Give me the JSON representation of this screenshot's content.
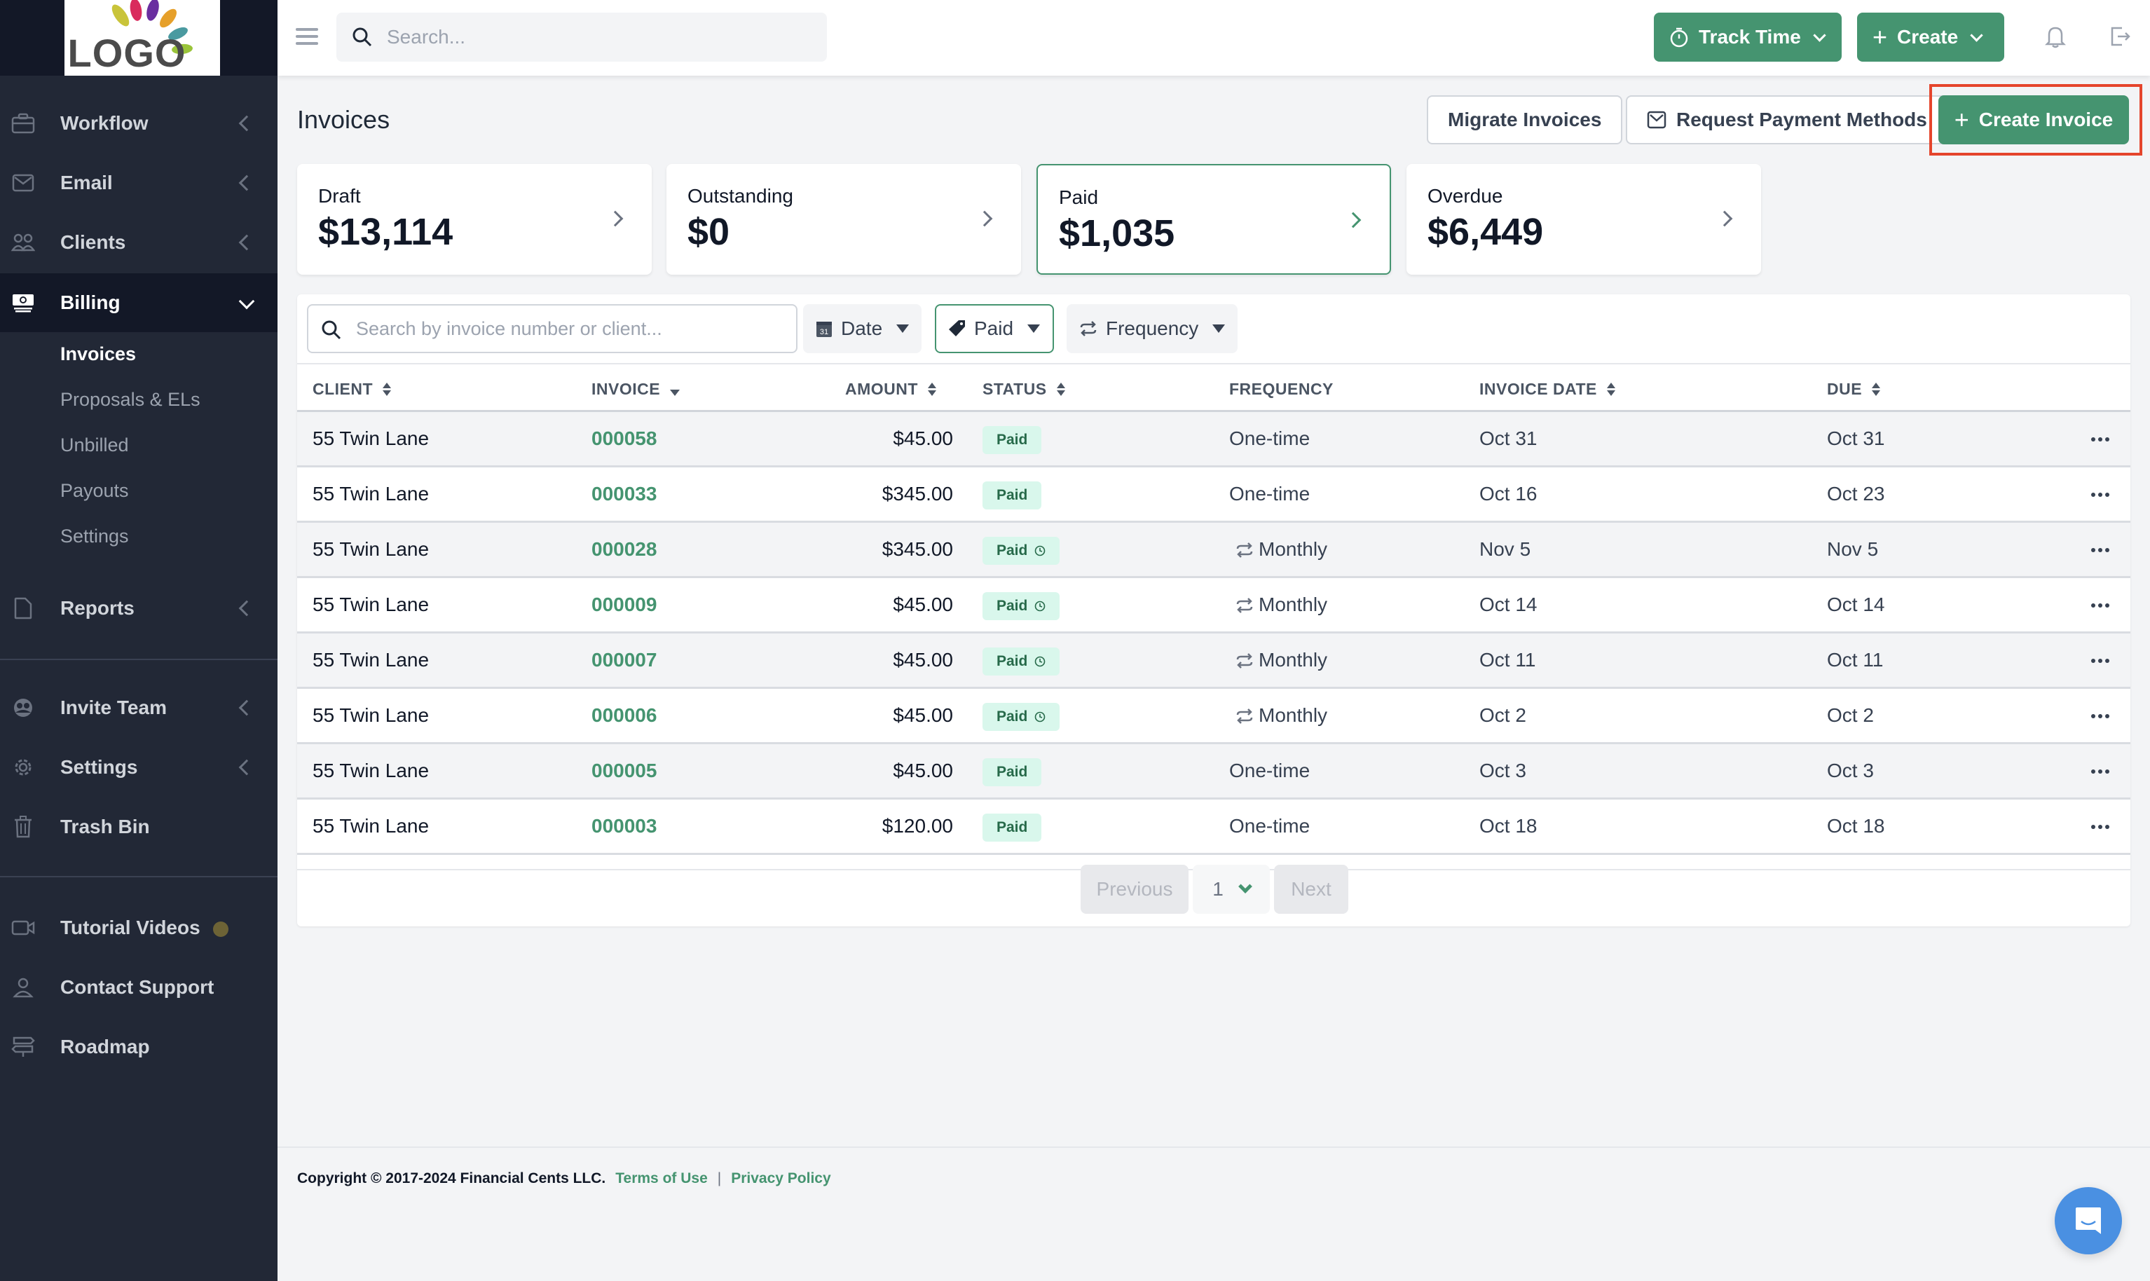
{
  "app": {
    "logo_text": "LOGO"
  },
  "sidebar": {
    "items": [
      {
        "label": "Workflow",
        "icon": "briefcase-icon",
        "expandable": true
      },
      {
        "label": "Email",
        "icon": "mail-icon",
        "expandable": true
      },
      {
        "label": "Clients",
        "icon": "users-icon",
        "expandable": true
      },
      {
        "label": "Billing",
        "icon": "money-icon",
        "expandable": true,
        "active": true
      },
      {
        "label": "Reports",
        "icon": "document-icon",
        "expandable": true
      },
      {
        "label": "Invite Team",
        "icon": "team-icon",
        "expandable": true
      },
      {
        "label": "Settings",
        "icon": "gear-icon",
        "expandable": true
      },
      {
        "label": "Trash Bin",
        "icon": "trash-icon",
        "expandable": false
      },
      {
        "label": "Tutorial Videos",
        "icon": "video-icon",
        "expandable": false,
        "dot_color": "#6d6336"
      },
      {
        "label": "Contact Support",
        "icon": "person-icon",
        "expandable": false
      },
      {
        "label": "Roadmap",
        "icon": "signpost-icon",
        "expandable": false
      }
    ],
    "billing_subitems": [
      {
        "label": "Invoices",
        "active": true
      },
      {
        "label": "Proposals & ELs"
      },
      {
        "label": "Unbilled"
      },
      {
        "label": "Payouts"
      },
      {
        "label": "Settings"
      }
    ]
  },
  "topbar": {
    "search_placeholder": "Search...",
    "track_time_label": "Track Time",
    "create_label": "Create"
  },
  "page": {
    "title": "Invoices",
    "migrate_label": "Migrate Invoices",
    "request_payment_label": "Request Payment Methods",
    "create_invoice_label": "Create Invoice"
  },
  "summary_cards": [
    {
      "title": "Draft",
      "value": "$13,114"
    },
    {
      "title": "Outstanding",
      "value": "$0"
    },
    {
      "title": "Paid",
      "value": "$1,035",
      "selected": true
    },
    {
      "title": "Overdue",
      "value": "$6,449"
    }
  ],
  "filters": {
    "search_placeholder": "Search by invoice number or client...",
    "date_label": "Date",
    "status_label": "Paid",
    "frequency_label": "Frequency"
  },
  "table": {
    "columns": [
      "CLIENT",
      "INVOICE",
      "AMOUNT",
      "STATUS",
      "FREQUENCY",
      "INVOICE DATE",
      "DUE"
    ],
    "rows": [
      {
        "client": "55 Twin Lane",
        "invoice": "000058",
        "amount": "$45.00",
        "status": "Paid",
        "recurring": false,
        "frequency": "One-time",
        "invoice_date": "Oct 31",
        "due": "Oct 31"
      },
      {
        "client": "55 Twin Lane",
        "invoice": "000033",
        "amount": "$345.00",
        "status": "Paid",
        "recurring": false,
        "frequency": "One-time",
        "invoice_date": "Oct 16",
        "due": "Oct 23"
      },
      {
        "client": "55 Twin Lane",
        "invoice": "000028",
        "amount": "$345.00",
        "status": "Paid",
        "recurring": true,
        "frequency": "Monthly",
        "invoice_date": "Nov 5",
        "due": "Nov 5"
      },
      {
        "client": "55 Twin Lane",
        "invoice": "000009",
        "amount": "$45.00",
        "status": "Paid",
        "recurring": true,
        "frequency": "Monthly",
        "invoice_date": "Oct 14",
        "due": "Oct 14"
      },
      {
        "client": "55 Twin Lane",
        "invoice": "000007",
        "amount": "$45.00",
        "status": "Paid",
        "recurring": true,
        "frequency": "Monthly",
        "invoice_date": "Oct 11",
        "due": "Oct 11"
      },
      {
        "client": "55 Twin Lane",
        "invoice": "000006",
        "amount": "$45.00",
        "status": "Paid",
        "recurring": true,
        "frequency": "Monthly",
        "invoice_date": "Oct 2",
        "due": "Oct 2"
      },
      {
        "client": "55 Twin Lane",
        "invoice": "000005",
        "amount": "$45.00",
        "status": "Paid",
        "recurring": false,
        "frequency": "One-time",
        "invoice_date": "Oct 3",
        "due": "Oct 3"
      },
      {
        "client": "55 Twin Lane",
        "invoice": "000003",
        "amount": "$120.00",
        "status": "Paid",
        "recurring": false,
        "frequency": "One-time",
        "invoice_date": "Oct 18",
        "due": "Oct 18"
      }
    ]
  },
  "pagination": {
    "previous_label": "Previous",
    "current_page": "1",
    "next_label": "Next"
  },
  "footer": {
    "copyright": "Copyright © 2017-2024 Financial Cents LLC.",
    "terms_label": "Terms of Use",
    "separator": "|",
    "privacy_label": "Privacy Policy"
  },
  "colors": {
    "brand_green": "#459470",
    "sidebar_bg": "#222836",
    "highlight_red": "#e5452c",
    "chat_blue": "#4a90e2"
  }
}
